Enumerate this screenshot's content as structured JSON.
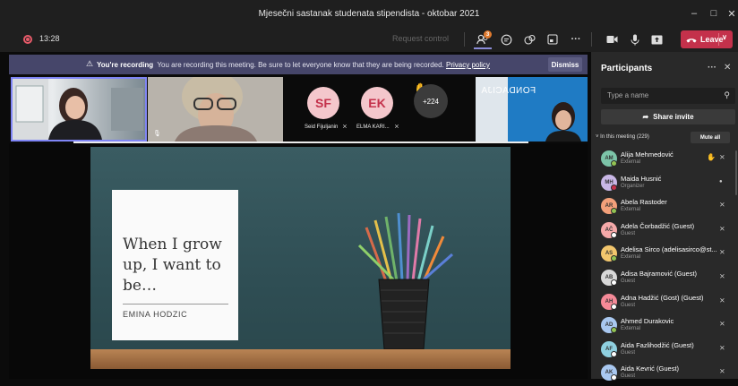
{
  "window": {
    "title": "Mjesečni sastanak studenata stipendista - oktobar 2021",
    "controls": [
      "minimize-icon",
      "maximize-icon",
      "close-icon"
    ]
  },
  "toolbar": {
    "timer": "13:28",
    "request_control": "Request control",
    "people_badge": "3",
    "leave_label": "Leave"
  },
  "banner": {
    "title": "You're recording",
    "message": "You are recording this meeting. Be sure to let everyone know that they are being recorded.",
    "link": "Privacy policy",
    "dismiss": "Dismiss"
  },
  "strip": {
    "avatars": [
      {
        "initials": "SF",
        "name": "Seid Fijuljanin"
      },
      {
        "initials": "EK",
        "name": "ELMA KARI..."
      }
    ],
    "more": "+224",
    "brand_text": "FONDACIJA"
  },
  "slide": {
    "headline": "When I grow up, I want to be…",
    "author": "EMINA HODZIC"
  },
  "panel": {
    "title": "Participants",
    "search_placeholder": "Type a name",
    "share_label": "Share invite",
    "section_label": "In this meeting (229)",
    "mute_all": "Mute all",
    "participants": [
      {
        "initials": "AM",
        "name": "Alija Mehmedović",
        "role": "External",
        "color": "#7cc4a8",
        "status": "#92c353",
        "hand": true,
        "icon": "mic-off-icon"
      },
      {
        "initials": "MH",
        "name": "Maida Husnić",
        "role": "Organizer",
        "color": "#c9b7e6",
        "status": "#c4314b",
        "hand": false,
        "icon": "mic-icon"
      },
      {
        "initials": "AR",
        "name": "Abela Rastoder",
        "role": "External",
        "color": "#f3a07a",
        "status": "#92c353",
        "hand": false,
        "icon": "mic-off-icon"
      },
      {
        "initials": "AČ",
        "name": "Adela Čorbadžić (Guest)",
        "role": "Guest",
        "color": "#f5a9a9",
        "status": "#ffffff",
        "hand": false,
        "icon": "mic-off-icon"
      },
      {
        "initials": "AS",
        "name": "Adelisa Sirco (adelisasirco@st...",
        "role": "External",
        "color": "#f2c66d",
        "status": "#92c353",
        "hand": false,
        "icon": "mic-off-icon"
      },
      {
        "initials": "AB",
        "name": "Adisa Bajramović (Guest)",
        "role": "Guest",
        "color": "#d8d8d8",
        "status": "#ffffff",
        "hand": false,
        "icon": "mic-off-icon"
      },
      {
        "initials": "AH",
        "name": "Adna Hadžić (Gost) (Guest)",
        "role": "Guest",
        "color": "#f58a98",
        "status": "#ffffff",
        "hand": false,
        "icon": "mic-off-icon"
      },
      {
        "initials": "AD",
        "name": "Ahmed Durakovic",
        "role": "External",
        "color": "#a9c8f0",
        "status": "#92c353",
        "hand": false,
        "icon": "mic-off-icon"
      },
      {
        "initials": "AF",
        "name": "Aida Fazlihodžić (Guest)",
        "role": "Guest",
        "color": "#8fd0e0",
        "status": "#ffffff",
        "hand": false,
        "icon": "mic-off-icon"
      },
      {
        "initials": "AK",
        "name": "Aida Kevrić (Guest)",
        "role": "Guest",
        "color": "#a9c8f0",
        "status": "#ffffff",
        "hand": false,
        "icon": "mic-off-icon"
      }
    ]
  }
}
